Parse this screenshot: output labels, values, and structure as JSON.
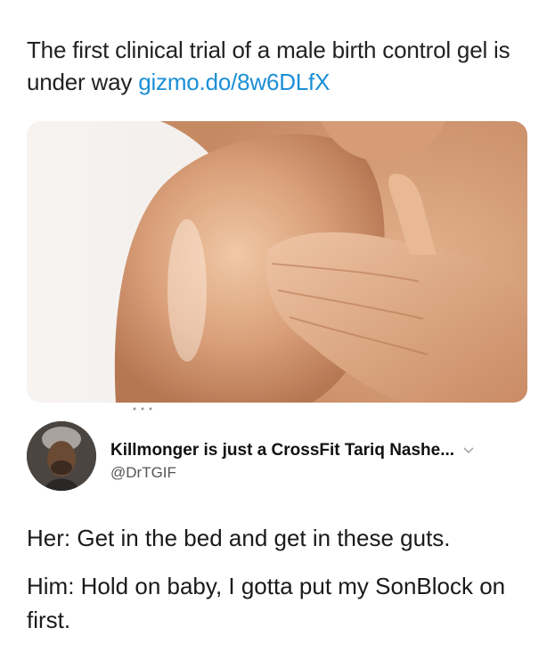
{
  "post": {
    "text": "The first clinical trial of a male birth control gel is under way ",
    "link": "gizmo.do/8w6DLfX"
  },
  "tweet": {
    "display_name": "Killmonger is just a CrossFit Tariq Nashe...",
    "handle": "@DrTGIF",
    "lines": [
      "Her: Get in the bed and get in these guts.",
      "Him: Hold on baby, I gotta put my SonBlock on first."
    ]
  },
  "icons": {
    "menu": "chevron-down-icon"
  },
  "colors": {
    "link": "#1b8fd6",
    "skin": "#d9a07a"
  }
}
